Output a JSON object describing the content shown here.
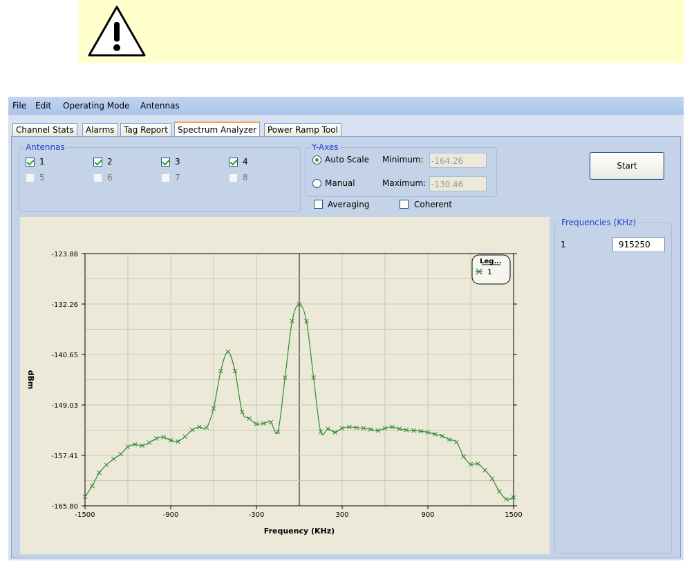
{
  "menu": [
    "File",
    "Edit",
    "Operating Mode",
    "Antennas"
  ],
  "tabs": [
    "Channel Stats",
    "Alarms",
    "Tag Report",
    "Spectrum Analyzer",
    "Power Ramp Tool"
  ],
  "active_tab": "Spectrum Analyzer",
  "antennas": {
    "title": "Antennas",
    "items": [
      {
        "label": "1",
        "checked": true,
        "enabled": true
      },
      {
        "label": "2",
        "checked": true,
        "enabled": true
      },
      {
        "label": "3",
        "checked": true,
        "enabled": true
      },
      {
        "label": "4",
        "checked": true,
        "enabled": true
      },
      {
        "label": "5",
        "checked": false,
        "enabled": false
      },
      {
        "label": "6",
        "checked": false,
        "enabled": false
      },
      {
        "label": "7",
        "checked": false,
        "enabled": false
      },
      {
        "label": "8",
        "checked": false,
        "enabled": false
      }
    ]
  },
  "y_axes": {
    "title": "Y-Axes",
    "auto_scale": "Auto Scale",
    "manual": "Manual",
    "minimum_label": "Minimum:",
    "maximum_label": "Maximum:",
    "minimum_value": "-164.26",
    "maximum_value": "-130.46",
    "selected": "Auto Scale"
  },
  "options": {
    "averaging": "Averaging",
    "coherent": "Coherent"
  },
  "start_button": "Start",
  "frequencies": {
    "title": "Frequencies (KHz)",
    "index": "1",
    "value": "915250"
  },
  "colors": {
    "series": "#2e8b2e",
    "chart_bg": "#ece9d8",
    "accent": "#1f3fd1"
  },
  "chart_data": {
    "type": "line",
    "xlabel": "Frequency (KHz)",
    "ylabel": "dBm",
    "xlim": [
      -1500,
      1500
    ],
    "ylim": [
      -165.8,
      -123.88
    ],
    "x_ticks": [
      "-1500",
      "-900",
      "-300",
      "300",
      "900",
      "1500"
    ],
    "y_ticks": [
      "-123.88",
      "-132.26",
      "-140.65",
      "-149.03",
      "-157.41",
      "-165.80"
    ],
    "legend": {
      "title": "Leg...",
      "position": "top-right"
    },
    "grid": true,
    "series": [
      {
        "name": "1",
        "x": [
          -1500,
          -1450,
          -1400,
          -1350,
          -1300,
          -1250,
          -1200,
          -1150,
          -1100,
          -1050,
          -1000,
          -950,
          -900,
          -850,
          -800,
          -750,
          -700,
          -650,
          -600,
          -550,
          -500,
          -450,
          -400,
          -350,
          -300,
          -250,
          -200,
          -150,
          -100,
          -50,
          0,
          50,
          100,
          150,
          200,
          250,
          300,
          350,
          400,
          450,
          500,
          550,
          600,
          650,
          700,
          750,
          800,
          850,
          900,
          950,
          1000,
          1050,
          1100,
          1150,
          1200,
          1250,
          1300,
          1350,
          1400,
          1450,
          1500
        ],
        "values": [
          -164.3,
          -162.5,
          -160.3,
          -159.0,
          -158.0,
          -157.2,
          -156.0,
          -155.6,
          -155.8,
          -155.3,
          -154.6,
          -154.4,
          -154.9,
          -155.1,
          -154.3,
          -153.2,
          -152.7,
          -152.8,
          -149.6,
          -143.4,
          -140.2,
          -143.4,
          -150.2,
          -151.3,
          -152.2,
          -152.1,
          -151.9,
          -153.5,
          -144.5,
          -135.1,
          -132.3,
          -135.1,
          -144.5,
          -153.5,
          -153.0,
          -153.6,
          -152.9,
          -152.7,
          -152.8,
          -152.9,
          -153.1,
          -153.3,
          -152.9,
          -152.7,
          -153.0,
          -153.2,
          -153.3,
          -153.4,
          -153.6,
          -153.9,
          -154.2,
          -154.8,
          -155.2,
          -157.6,
          -158.9,
          -158.8,
          -159.9,
          -161.3,
          -163.4,
          -164.7,
          -164.4
        ]
      }
    ]
  }
}
